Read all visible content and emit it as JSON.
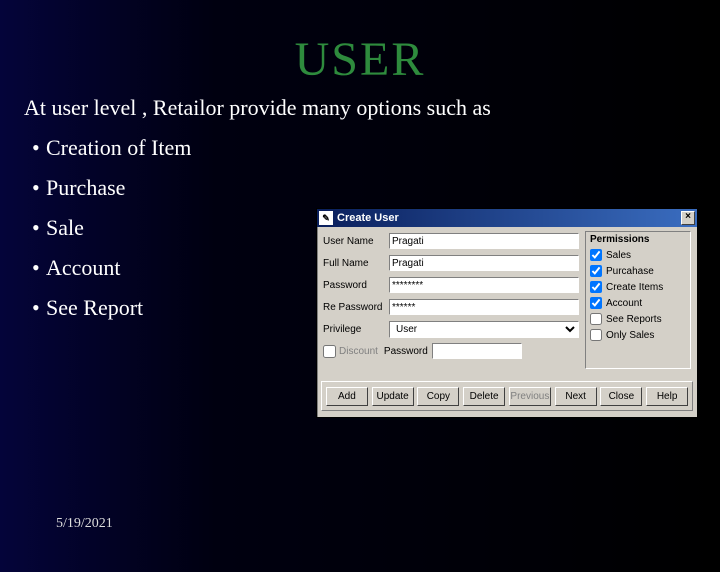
{
  "slide": {
    "title": "USER",
    "subtitle": "At user level , Retailor provide many options such as",
    "bullets": [
      "Creation of Item",
      "Purchase",
      "Sale",
      "Account",
      "See Report"
    ],
    "date": "5/19/2021"
  },
  "dialog": {
    "title": "Create User",
    "fields": {
      "username_label": "User Name",
      "username_value": "Pragati",
      "fullname_label": "Full Name",
      "fullname_value": "Pragati",
      "password_label": "Password",
      "password_value": "********",
      "repassword_label": "Re Password",
      "repassword_value": "******",
      "privilege_label": "Privilege",
      "privilege_value": "User",
      "discount_label": "Discount",
      "discount_pw_label": "Password",
      "discount_pw_value": ""
    },
    "permissions": {
      "group_title": "Permissions",
      "items": [
        {
          "label": "Sales",
          "checked": true
        },
        {
          "label": "Purcahase",
          "checked": true
        },
        {
          "label": "Create Items",
          "checked": true
        },
        {
          "label": "Account",
          "checked": true
        },
        {
          "label": "See Reports",
          "checked": false
        },
        {
          "label": "Only Sales",
          "checked": false
        }
      ]
    },
    "buttons": {
      "add": "Add",
      "update": "Update",
      "copy": "Copy",
      "delete": "Delete",
      "previous": "Previous",
      "next": "Next",
      "close": "Close",
      "help": "Help"
    }
  }
}
